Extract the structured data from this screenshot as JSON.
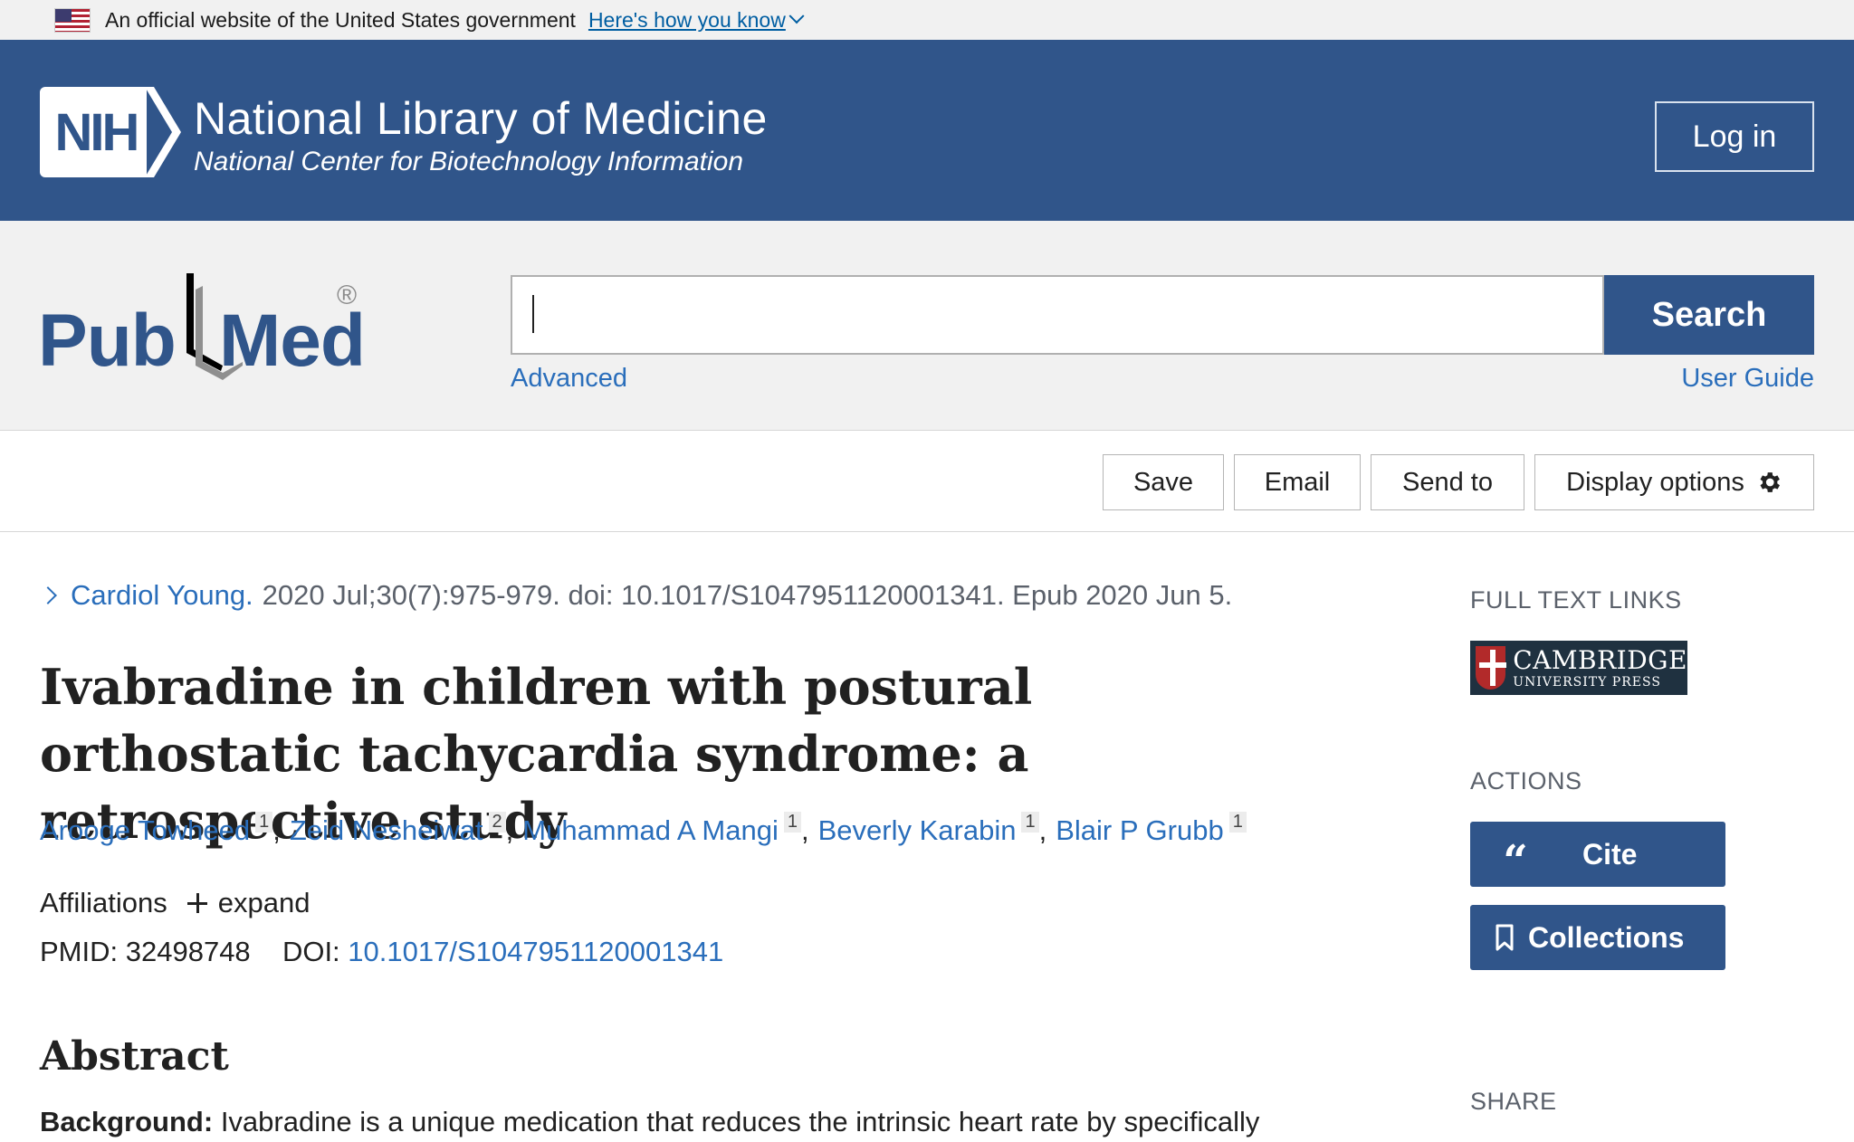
{
  "gov_banner": {
    "text": "An official website of the United States government",
    "link": "Here's how you know"
  },
  "header": {
    "logo_text": "NIH",
    "title": "National Library of Medicine",
    "subtitle": "National Center for Biotechnology Information",
    "login": "Log in"
  },
  "search": {
    "logo_left": "Pub",
    "logo_right": "Med",
    "logo_reg": "®",
    "value": "",
    "button": "Search",
    "advanced": "Advanced",
    "user_guide": "User Guide"
  },
  "toolbar": {
    "save": "Save",
    "email": "Email",
    "send_to": "Send to",
    "display_options": "Display options"
  },
  "article": {
    "journal": "Cardiol Young.",
    "citation": "2020 Jul;30(7):975-979. doi: 10.1017/S1047951120001341. Epub 2020 Jun 5.",
    "title": "Ivabradine in children with postural orthostatic tachycardia syndrome: a retrospective study",
    "authors": [
      {
        "name": "Arooge Towheed",
        "aff": "1"
      },
      {
        "name": "Zeid Nesheiwat",
        "aff": "2"
      },
      {
        "name": "Muhammad A Mangi",
        "aff": "1"
      },
      {
        "name": "Beverly Karabin",
        "aff": "1"
      },
      {
        "name": "Blair P Grubb",
        "aff": "1"
      }
    ],
    "affiliations_label": "Affiliations",
    "expand": "expand",
    "pmid_label": "PMID:",
    "pmid": "32498748",
    "doi_label": "DOI:",
    "doi": "10.1017/S1047951120001341",
    "abstract_heading": "Abstract",
    "abstract_bg_label": "Background:",
    "abstract_bg_text": "Ivabradine is a unique medication that reduces the intrinsic heart rate by specifically"
  },
  "sidebar": {
    "full_text_links": "FULL TEXT LINKS",
    "publisher_line1": "CAMBRIDGE",
    "publisher_line2": "UNIVERSITY PRESS",
    "actions": "ACTIONS",
    "cite": "Cite",
    "collections": "Collections",
    "share": "SHARE"
  },
  "colors": {
    "nih_blue": "#30558a",
    "link_blue": "#2a6ebb",
    "gov_link": "#005ea2"
  }
}
